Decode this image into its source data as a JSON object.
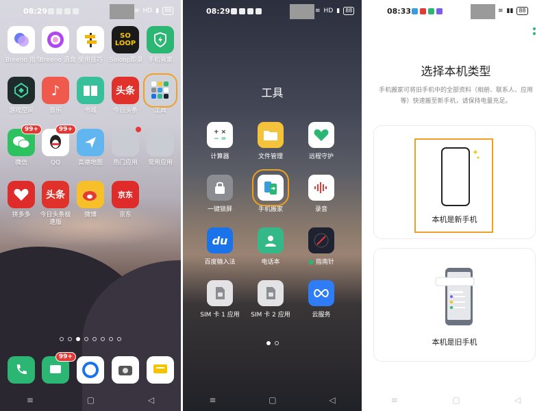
{
  "screen1": {
    "time": "08:29",
    "status_hd": "HD",
    "battery": "88",
    "apps": [
      {
        "label": "Breeno 指令",
        "color": "#8e7cf0"
      },
      {
        "label": "Breeno 语音",
        "color": "#b048f0"
      },
      {
        "label": "使用技巧",
        "color": "#ffffff"
      },
      {
        "label": "Soloop即录",
        "color": "#1a1a1a"
      },
      {
        "label": "手机管家",
        "color": "#2bb673"
      },
      {
        "label": "游戏空间",
        "color": "#1f2a2a"
      },
      {
        "label": "音乐",
        "color": "#ef5a4c"
      },
      {
        "label": "书城",
        "color": "#38c09a"
      },
      {
        "label": "今日头条",
        "color": "#e0312a"
      },
      {
        "label": "工具",
        "color": "#cfd2d8"
      },
      {
        "label": "微信",
        "color": "#2dc15f"
      },
      {
        "label": "QQ",
        "color": "#ffffff"
      },
      {
        "label": "高德地图",
        "color": "#62b6f0"
      },
      {
        "label": "热门应用",
        "color": "#c9ccd2"
      },
      {
        "label": "常用应用",
        "color": "#c9ccd2"
      },
      {
        "label": "拼多多",
        "color": "#e02b2b"
      },
      {
        "label": "今日头条极速版",
        "color": "#e0312a"
      },
      {
        "label": "微博",
        "color": "#f7c02a"
      },
      {
        "label": "京东",
        "color": "#e02b2b"
      }
    ],
    "icon_text": {
      "soloop": "SO LOOP",
      "toutiao": "头条",
      "jd": "京东"
    },
    "badges": {
      "wechat": "99+",
      "qq": "99+",
      "dock_msg": "99+"
    },
    "dock": [
      {
        "name": "phone",
        "color": "#2bb673"
      },
      {
        "name": "messages",
        "color": "#2bb673"
      },
      {
        "name": "browser",
        "color": "#ffffff"
      },
      {
        "name": "camera",
        "color": "#ffffff"
      },
      {
        "name": "notes",
        "color": "#ffffff"
      }
    ]
  },
  "screen2": {
    "time": "08:29",
    "status_hd": "HD",
    "battery": "88",
    "folder_title": "工具",
    "apps": [
      {
        "label": "计算器",
        "color": "#ffffff"
      },
      {
        "label": "文件管理",
        "color": "#f5c33b"
      },
      {
        "label": "远程守护",
        "color": "#ffffff"
      },
      {
        "label": "一键锁屏",
        "color": "#8c8d92"
      },
      {
        "label": "手机搬家",
        "color": "#ffffff"
      },
      {
        "label": "录音",
        "color": "#ffffff"
      },
      {
        "label": "百度输入法",
        "color": "#1a73e8"
      },
      {
        "label": "电话本",
        "color": "#35b887"
      },
      {
        "label": "指南针",
        "color": "#1f2230"
      },
      {
        "label": "SIM 卡 1 应用",
        "color": "#e3e3e6"
      },
      {
        "label": "SIM 卡 2 应用",
        "color": "#e3e3e6"
      },
      {
        "label": "云服务",
        "color": "#2e7cf6"
      }
    ],
    "baidu_icon_text": "du"
  },
  "screen3": {
    "time": "08:33",
    "battery": "88",
    "title": "选择本机类型",
    "description": "手机搬家可将旧手机中的全部资料（相册、联系人、应用等）快速搬至新手机，请保持电量充足。",
    "option_new": "本机是新手机",
    "option_old": "本机是旧手机",
    "accent": "#f0a020"
  }
}
